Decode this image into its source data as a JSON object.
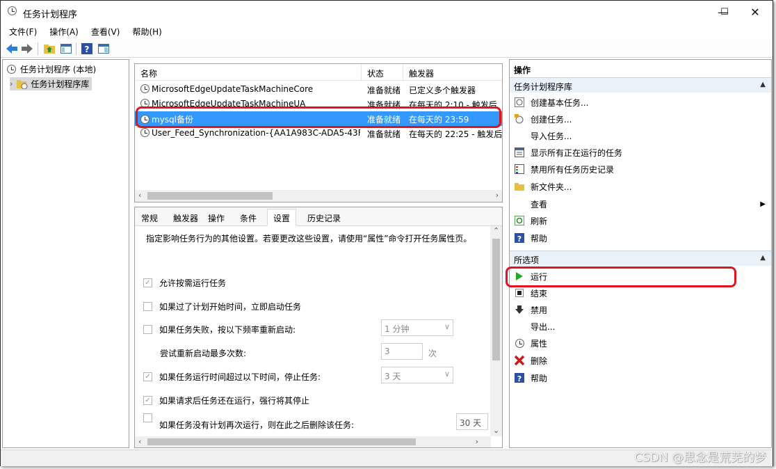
{
  "window": {
    "title": "任务计划程序",
    "min": "—",
    "max": "☐",
    "close": "✕"
  },
  "menu": [
    "文件(F)",
    "操作(A)",
    "查看(V)",
    "帮助(H)"
  ],
  "tree": {
    "root": "任务计划程序 (本地)",
    "child": "任务计划程序库"
  },
  "task_list": {
    "columns": [
      "名称",
      "状态",
      "触发器"
    ],
    "rows": [
      {
        "name": "MicrosoftEdgeUpdateTaskMachineCore",
        "status": "准备就绪",
        "trigger": "已定义多个触发器"
      },
      {
        "name": "MicrosoftEdgeUpdateTaskMachineUA",
        "status": "准备就绪",
        "trigger": "在每天的 2:10 - 触发后"
      },
      {
        "name": "mysql备份",
        "status": "准备就绪",
        "trigger": "在每天的 23:59"
      },
      {
        "name": "User_Feed_Synchronization-{AA1A983C-ADA5-43F...",
        "status": "准备就绪",
        "trigger": "在每天的 22:25 - 触发后"
      }
    ]
  },
  "tabs": [
    "常规",
    "触发器",
    "操作",
    "条件",
    "设置",
    "历史记录"
  ],
  "settings": {
    "description": "指定影响任务行为的其他设置。若要更改这些设置，请使用“属性”命令打开任务属性页。",
    "options": [
      {
        "label": "允许按需运行任务",
        "checked": true
      },
      {
        "label": "如果过了计划开始时间，立即启动任务",
        "checked": false
      },
      {
        "label": "如果任务失败，按以下频率重新启动:",
        "checked": false
      },
      {
        "label": "尝试重新启动最多次数:",
        "checked": null
      },
      {
        "label": "如果任务运行时间超过以下时间，停止任务:",
        "checked": true
      },
      {
        "label": "如果请求后任务还在运行，强行将其停止",
        "checked": true
      },
      {
        "label": "如果任务没有计划再次运行，则在此之后删除该任务:",
        "checked": false
      }
    ],
    "restart_interval": "1 分钟",
    "restart_count": "3",
    "restart_count_unit": "次",
    "stop_after": "3 天",
    "delete_after": "30 天"
  },
  "actions_pane": {
    "header": "操作",
    "section1": "任务计划程序库",
    "items1": [
      "创建基本任务...",
      "创建任务...",
      "导入任务...",
      "显示所有正在运行的任务",
      "禁用所有任务历史记录",
      "新文件夹...",
      "查看",
      "刷新",
      "帮助"
    ],
    "section2": "所选项",
    "items2": [
      "运行",
      "结束",
      "禁用",
      "导出...",
      "属性",
      "删除",
      "帮助"
    ]
  },
  "watermark": "CSDN @思念是荒芜的梦"
}
